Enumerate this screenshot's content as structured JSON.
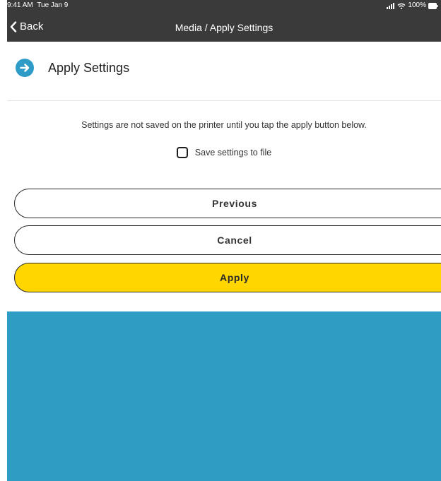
{
  "status_bar": {
    "time": "9:41 AM",
    "date": "Tue Jan 9",
    "battery": "100%"
  },
  "nav": {
    "back_label": "Back",
    "title": "Media / Apply Settings"
  },
  "header": {
    "title": "Apply Settings",
    "icon": "arrow-right-circle-icon"
  },
  "content": {
    "info_text": "Settings are not saved on the printer until you tap the apply button below.",
    "save_checkbox_label": "Save settings to file",
    "save_checkbox_checked": false
  },
  "buttons": {
    "previous": "Previous",
    "cancel": "Cancel",
    "apply": "Apply"
  },
  "colors": {
    "topbar": "#3a3a3a",
    "accent_blue": "#2e9dc4",
    "apply_yellow": "#ffd600"
  }
}
